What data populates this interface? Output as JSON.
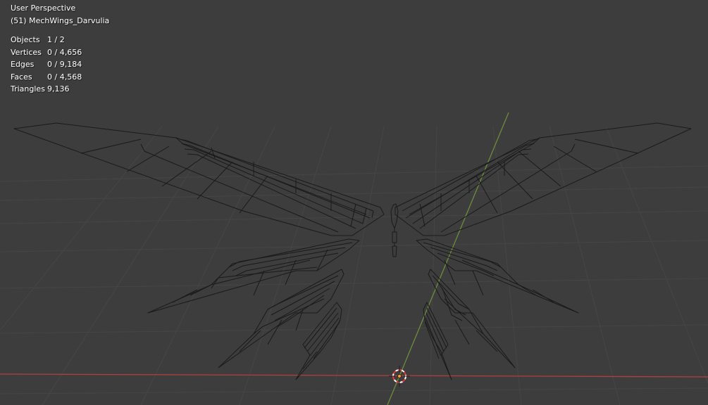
{
  "viewport": {
    "view_name": "User Perspective",
    "object_label": "(51) MechWings_Darvulia",
    "stats": [
      {
        "label": "Objects",
        "value": "1 / 2"
      },
      {
        "label": "Vertices",
        "value": "0 / 4,656"
      },
      {
        "label": "Edges",
        "value": "0 / 9,184"
      },
      {
        "label": "Faces",
        "value": "0 / 4,568"
      },
      {
        "label": "Triangles",
        "value": "9,136"
      }
    ]
  },
  "colors": {
    "background": "#3d3d3d",
    "grid": "#464646",
    "x_axis": "#b04040",
    "y_axis": "#6e8c3c",
    "wireframe": "#1a1a1a",
    "cursor_red": "#d83a3a",
    "cursor_white": "#ffffff",
    "origin": "#f0a030"
  },
  "icons": {
    "cursor": "3d-cursor-icon",
    "origin": "object-origin-icon"
  }
}
